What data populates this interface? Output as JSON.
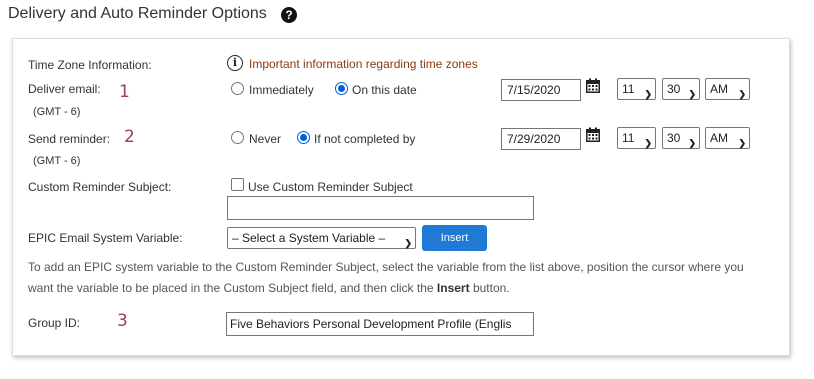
{
  "section": {
    "title": "Delivery and Auto Reminder Options",
    "help_icon_glyph": "?"
  },
  "timezone": {
    "label": "Time Zone Information:",
    "info_glyph": "i",
    "info_text": "Important information regarding time zones"
  },
  "deliver": {
    "label": "Deliver email:",
    "marker": "1",
    "tz": "(GMT - 6)",
    "option_immediately": "Immediately",
    "option_on_date": "On this date",
    "selected": "On this date",
    "date": "7/15/2020",
    "hour": "11",
    "minute": "30",
    "ampm": "AM"
  },
  "reminder": {
    "label": "Send reminder:",
    "marker": "2",
    "tz": "(GMT - 6)",
    "option_never": "Never",
    "option_if_not_completed": "If not completed by",
    "selected": "If not completed by",
    "date": "7/29/2020",
    "hour": "11",
    "minute": "30",
    "ampm": "AM"
  },
  "custom_subject": {
    "label": "Custom Reminder Subject:",
    "checkbox_label": "Use Custom Reminder Subject",
    "checked": false,
    "value": ""
  },
  "variable": {
    "label": "EPIC Email System Variable:",
    "selected": "– Select a System Variable –",
    "insert_label": "Insert"
  },
  "help": {
    "text_before": "To add an EPIC system variable to the Custom Reminder Subject, select the variable from the list above, position the cursor where you want the variable to be placed in the Custom Subject field, and then click the ",
    "bold": "Insert",
    "text_after": " button."
  },
  "group": {
    "label": "Group ID:",
    "marker": "3",
    "value": "Five Behaviors Personal Development Profile (Englis"
  },
  "icons": {
    "help": "question-circle-icon",
    "info": "info-circle-icon",
    "calendar": "calendar-icon",
    "chevron": "chevron-down-icon"
  },
  "colors": {
    "accent": "#1f7ad6",
    "info_text": "#8b3a0e",
    "marker": "#9c3a6f"
  }
}
